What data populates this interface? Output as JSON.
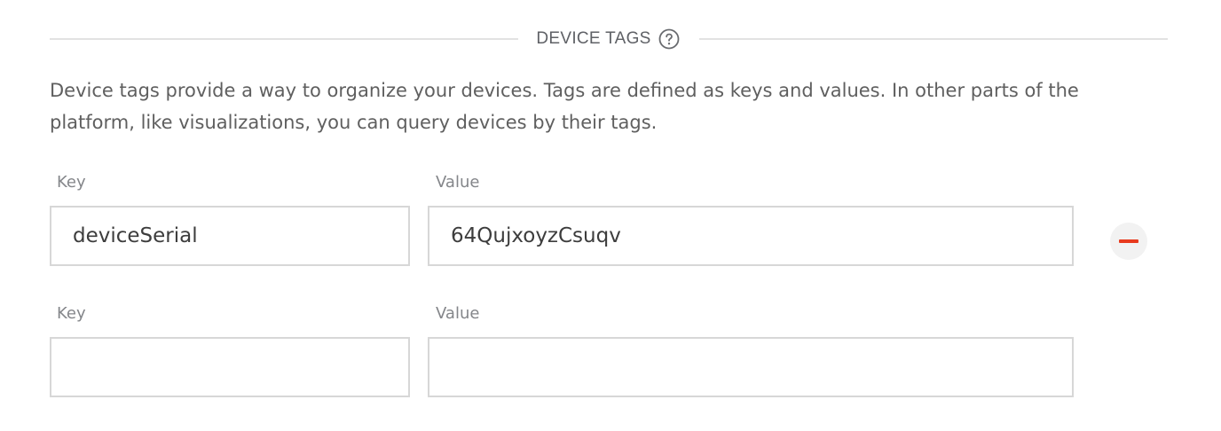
{
  "section": {
    "title": "DEVICE TAGS",
    "help_icon": "question-circle-icon",
    "description": "Device tags provide a way to organize your devices. Tags are defined as keys and values. In other parts of the platform, like visualizations, you can query devices by their tags."
  },
  "tags": [
    {
      "key_label": "Key",
      "value_label": "Value",
      "key": "deviceSerial",
      "value": "64QujxoyzCsuqv",
      "remove_icon": "minus-icon"
    },
    {
      "key_label": "Key",
      "value_label": "Value",
      "key": "",
      "value": ""
    }
  ],
  "colors": {
    "remove_accent": "#e83a1e",
    "border": "#d7d7d7"
  }
}
